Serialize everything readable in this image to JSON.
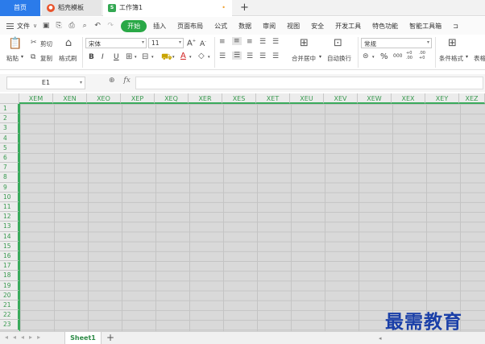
{
  "titlebar": {
    "home_tab": "首页",
    "template_tab": "稻壳模板",
    "workbook_tab": "工作簿1",
    "unsaved_dot": "•",
    "add_tab": "+"
  },
  "menubar": {
    "file": "文件",
    "start": "开始",
    "items": [
      "插入",
      "页面布局",
      "公式",
      "数据",
      "审阅",
      "视图",
      "安全",
      "开发工具",
      "特色功能",
      "智能工具箱"
    ]
  },
  "ribbon": {
    "paste": "粘贴",
    "cut": "剪切",
    "copy": "复制",
    "format_painter": "格式刷",
    "font_name": "宋体",
    "font_size": "11",
    "bold": "B",
    "italic": "I",
    "underline": "U",
    "merge_center": "合并居中",
    "wrap_text": "自动换行",
    "number_format": "常规",
    "percent": "%",
    "thousands": "000",
    "inc_decimal": "+0 .00",
    "dec_decimal": ".00 +0",
    "conditional_format": "条件格式",
    "table_style": "表格"
  },
  "formula_bar": {
    "cell_ref": "E1",
    "fx": "fx"
  },
  "grid": {
    "columns": [
      "XEM",
      "XEN",
      "XEO",
      "XEP",
      "XEQ",
      "XER",
      "XES",
      "XET",
      "XEU",
      "XEV",
      "XEW",
      "XEX",
      "XEY",
      "XEZ"
    ],
    "rows": [
      "1",
      "2",
      "3",
      "4",
      "5",
      "6",
      "7",
      "8",
      "9",
      "10",
      "11",
      "12",
      "13",
      "14",
      "15",
      "16",
      "17",
      "18",
      "19",
      "20",
      "21",
      "22",
      "23"
    ]
  },
  "sheetbar": {
    "sheet_name": "Sheet1",
    "add_sheet": "+"
  },
  "watermark": "最需教育",
  "colors": {
    "accent_blue": "#2b7bea",
    "start_green": "#29a846",
    "header_green": "#3a9a50",
    "grid_gray": "#d9d9d9",
    "watermark_blue": "#1a3fa8"
  }
}
